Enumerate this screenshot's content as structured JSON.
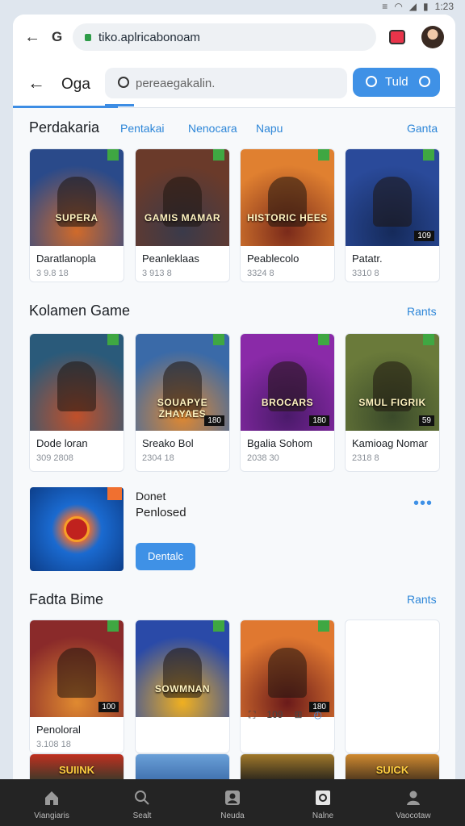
{
  "status_bar": {
    "time": "1:23"
  },
  "browser": {
    "url": "tiko.aplricabonoam"
  },
  "app_bar": {
    "title": "Oga",
    "search_placeholder": "pereaegakalin.",
    "button_label": "Tuld"
  },
  "sections": [
    {
      "title": "Perdakaria",
      "tabs": [
        "Pentakai",
        "Nenocara",
        "Napu"
      ],
      "link": "Ganta",
      "cards": [
        {
          "name": "Daratlanopla",
          "meta": "3 9.8 18",
          "art_title": "SUPERA",
          "badge": "",
          "colors": [
            "#2a4a8a",
            "#d06a2a"
          ]
        },
        {
          "name": "Peanleklaas",
          "meta": "3 913 8",
          "art_title": "GAMIS MAMAR",
          "badge": "",
          "colors": [
            "#6a3a2a",
            "#3a3a4a"
          ]
        },
        {
          "name": "Peablecolo",
          "meta": "3324 8",
          "art_title": "HISTORIC HEES",
          "badge": "",
          "colors": [
            "#e08030",
            "#7a2a1a"
          ]
        },
        {
          "name": "Patatr.",
          "meta": "3310 8",
          "art_title": "",
          "badge": "109",
          "colors": [
            "#2a4a9a",
            "#152a5a"
          ]
        }
      ]
    },
    {
      "title": "Kolamen Game",
      "link": "Rants",
      "cards": [
        {
          "name": "Dode loran",
          "meta": "309 2808",
          "art_title": "",
          "badge": "",
          "colors": [
            "#2a5a7a",
            "#c0502a"
          ]
        },
        {
          "name": "Sreako Bol",
          "meta": "2304 18",
          "art_title": "SOUAPYE ZHAYAES",
          "badge": "180",
          "colors": [
            "#3a6aa8",
            "#e08830"
          ]
        },
        {
          "name": "Bgalia Sohom",
          "meta": "2038 30",
          "art_title": "BROCARS",
          "badge": "180",
          "colors": [
            "#8a2aa8",
            "#4a1a6a"
          ]
        },
        {
          "name": "Kamioag Nomar",
          "meta": "2318 8",
          "art_title": "SMUL FIGRIK",
          "badge": "59",
          "colors": [
            "#6a7a3a",
            "#3a4a2a"
          ]
        }
      ]
    },
    {
      "featured": {
        "title": "Donet",
        "subtitle": "Penlosed",
        "button": "Dentalc"
      }
    },
    {
      "title": "Fadta Bime",
      "link": "Rants",
      "cards": [
        {
          "name": "Penoloral",
          "meta": "3.108 18",
          "art_title": "",
          "badge": "100",
          "colors": [
            "#8a2a2a",
            "#e08a30"
          ]
        },
        {
          "name": "",
          "meta": "",
          "art_title": "SOWMNAN",
          "badge": "",
          "colors": [
            "#2a4aa8",
            "#f0b020"
          ]
        },
        {
          "name": "",
          "meta": "",
          "art_title": "",
          "badge": "180",
          "colors": [
            "#e07830",
            "#6a1a1a"
          ],
          "actions": [
            "⛶",
            "109",
            "⊞",
            "◴"
          ]
        },
        {
          "name": "",
          "meta": "",
          "art_title": "",
          "badge": "",
          "empty": true
        }
      ]
    }
  ],
  "partial_row_titles": [
    "SUIINK",
    "",
    "",
    "SUICK"
  ],
  "bottom_nav": [
    {
      "label": "Viangiaris",
      "icon": "home-icon"
    },
    {
      "label": "Sealt",
      "icon": "search-icon"
    },
    {
      "label": "Neuda",
      "icon": "account-box-icon"
    },
    {
      "label": "Nalne",
      "icon": "screen-icon"
    },
    {
      "label": "Vaocotaw",
      "icon": "person-icon"
    }
  ]
}
